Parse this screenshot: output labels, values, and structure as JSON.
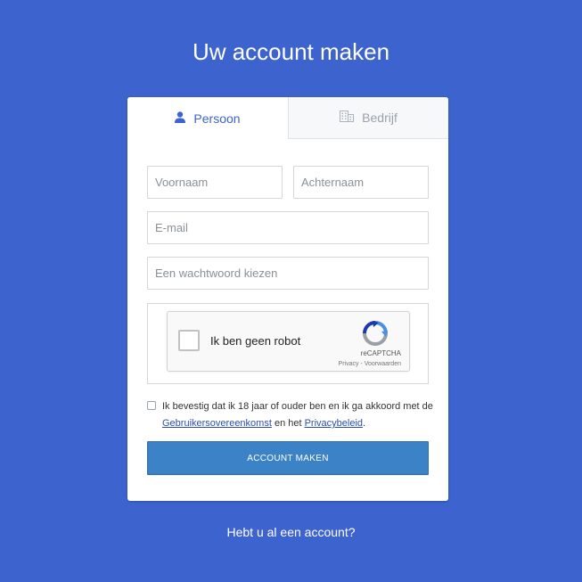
{
  "page": {
    "title": "Uw account maken",
    "background_color": "#3d63cf",
    "accent_color": "#3d63cf",
    "button_color": "#3b82c7"
  },
  "tabs": [
    {
      "label": "Persoon",
      "icon": "person-icon",
      "active": true
    },
    {
      "label": "Bedrijf",
      "icon": "building-icon",
      "active": false
    }
  ],
  "form": {
    "first_name": {
      "placeholder": "Voornaam",
      "value": ""
    },
    "last_name": {
      "placeholder": "Achternaam",
      "value": ""
    },
    "email": {
      "placeholder": "E-mail",
      "value": ""
    },
    "password": {
      "placeholder": "Een wachtwoord kiezen",
      "value": ""
    }
  },
  "recaptcha": {
    "label": "Ik ben geen robot",
    "brand": "reCAPTCHA",
    "privacy": "Privacy",
    "separator": " - ",
    "terms": "Voorwaarden",
    "icon": "recaptcha-logo-icon"
  },
  "terms": {
    "text_before": "Ik bevestig dat ik 18 jaar of ouder ben en ik ga akkoord met de ",
    "link_agreement": "Gebruikersovereenkomst",
    "text_middle": " en het ",
    "link_privacy": "Privacybeleid",
    "text_after": "."
  },
  "submit_label": "ACCOUNT MAKEN",
  "login_link": "Hebt u al een account?"
}
